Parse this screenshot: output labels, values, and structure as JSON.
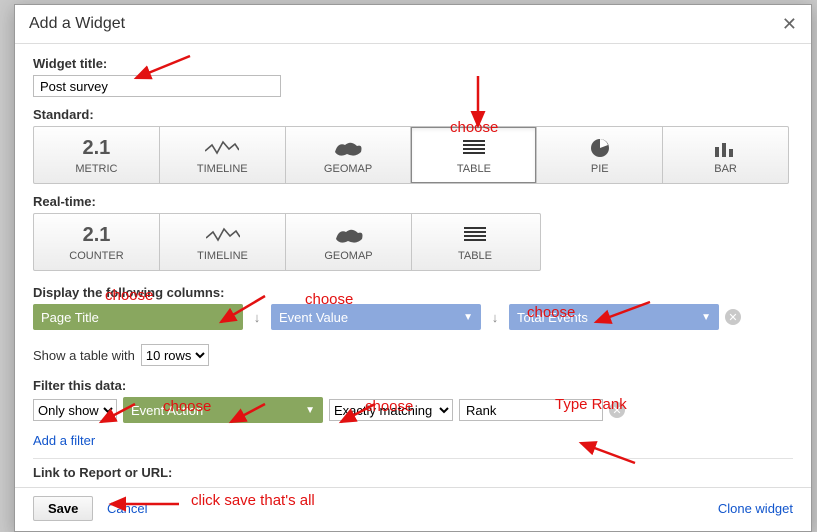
{
  "modal": {
    "title": "Add a Widget",
    "close_glyph": "✕"
  },
  "widget_title": {
    "label": "Widget title:",
    "value": "Post survey"
  },
  "standard": {
    "label": "Standard:",
    "types": [
      {
        "key": "metric",
        "label": "METRIC",
        "icon_text": "2.1"
      },
      {
        "key": "timeline",
        "label": "TIMELINE"
      },
      {
        "key": "geomap",
        "label": "GEOMAP"
      },
      {
        "key": "table",
        "label": "TABLE",
        "selected": true
      },
      {
        "key": "pie",
        "label": "PIE"
      },
      {
        "key": "bar",
        "label": "BAR"
      }
    ]
  },
  "realtime": {
    "label": "Real-time:",
    "types": [
      {
        "key": "counter",
        "label": "COUNTER",
        "icon_text": "2.1"
      },
      {
        "key": "timeline",
        "label": "TIMELINE"
      },
      {
        "key": "geomap",
        "label": "GEOMAP"
      },
      {
        "key": "table",
        "label": "TABLE"
      }
    ]
  },
  "columns": {
    "label": "Display the following columns:",
    "col1": "Page Title",
    "col2": "Event Value",
    "col3": "Total Events"
  },
  "table_rows": {
    "label_prefix": "Show a table with",
    "value": "10 rows"
  },
  "filter": {
    "label": "Filter this data:",
    "mode": "Only show",
    "dimension": "Event Action",
    "match": "Exactly matching",
    "value": "Rank",
    "add_filter": "Add a filter"
  },
  "link_section": {
    "label": "Link to Report or URL:"
  },
  "footer": {
    "save": "Save",
    "cancel": "Cancel",
    "clone": "Clone widget"
  },
  "annotations": {
    "choose": "choose",
    "type_rank": "Type Rank",
    "click_save": "click save that's all"
  }
}
